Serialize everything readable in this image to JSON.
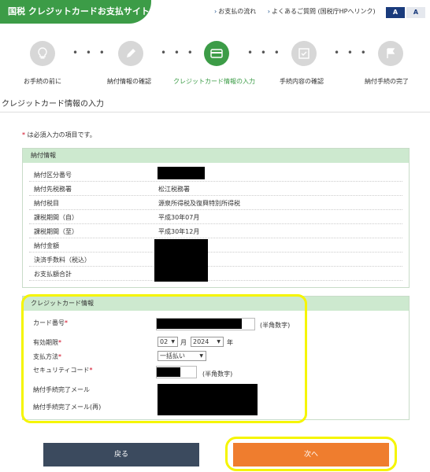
{
  "header": {
    "site_title": "国税 クレジットカードお支払サイト",
    "links": [
      "お支払の流れ",
      "よくあるご質問 (国税庁HPへリンク)"
    ],
    "font_size_buttons": [
      "A",
      "A"
    ]
  },
  "steps": [
    {
      "label": "お手続の前に",
      "icon": "lightbulb-icon",
      "active": false
    },
    {
      "label": "納付情報の確認",
      "icon": "pencil-icon",
      "active": false
    },
    {
      "label": "クレジットカード情報の入力",
      "icon": "credit-card-icon",
      "active": true
    },
    {
      "label": "手続内容の確認",
      "icon": "checklist-icon",
      "active": false
    },
    {
      "label": "納付手続の完了",
      "icon": "flag-icon",
      "active": false
    }
  ],
  "page_title": "クレジットカード情報の入力",
  "required_note": {
    "mark": "*",
    "text": "は必須入力の項目です。"
  },
  "payment_info": {
    "heading": "納付情報",
    "rows": [
      {
        "label": "納付区分番号",
        "value": "-"
      },
      {
        "label": "納付先税務署",
        "value": "松江税務署"
      },
      {
        "label": "納付税目",
        "value": "源泉所得税及復興特別所得税"
      },
      {
        "label": "課税期間（自）",
        "value": "平成30年07月"
      },
      {
        "label": "課税期間（至）",
        "value": "平成30年12月"
      },
      {
        "label": "納付金額",
        "value": ""
      },
      {
        "label": "決済手数料（税込）",
        "value": ""
      },
      {
        "label": "お支払額合計",
        "value": ""
      }
    ]
  },
  "card_info": {
    "heading": "クレジットカード情報",
    "card_number_label": "カード番号",
    "card_number_hint": "(半角数字)",
    "expiry_label": "有効期限",
    "expiry_month": "02",
    "month_unit": "月",
    "expiry_year": "2024",
    "year_unit": "年",
    "payment_method_label": "支払方法",
    "payment_method_value": "一括払い",
    "security_code_label": "セキュリティコード",
    "security_code_hint": "(半角数字)",
    "email_label": "納付手続完了メール",
    "email_confirm_label": "納付手続完了メール(再)"
  },
  "buttons": {
    "back": "戻る",
    "next": "次へ"
  }
}
